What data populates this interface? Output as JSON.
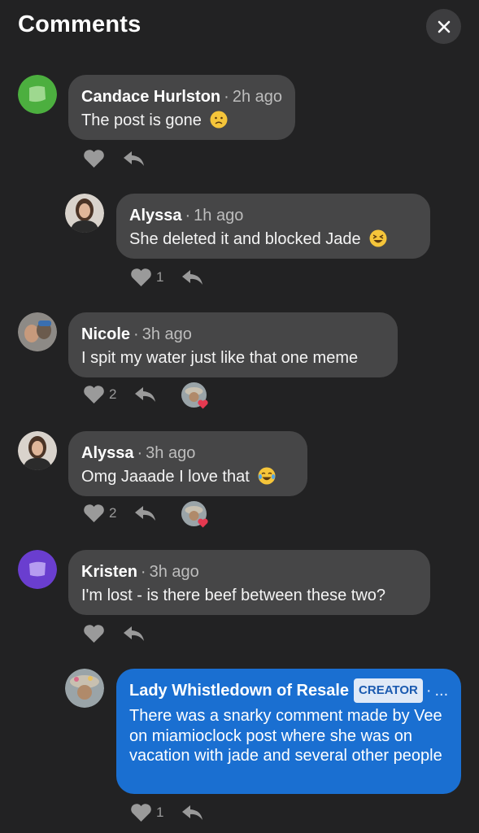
{
  "header": {
    "title": "Comments",
    "close_icon": "close-icon"
  },
  "colors": {
    "background": "#222223",
    "bubble": "#464647",
    "creator_bubble": "#1a6fd1",
    "icon": "#9a9a9a",
    "react_heart": "#e53950"
  },
  "comments": [
    {
      "name": "Candace Hurlston",
      "time": "2h ago",
      "text": "The post is gone",
      "emoji": "sad-face-emoji",
      "likes": ""
    },
    {
      "name": "Alyssa",
      "time": "1h ago",
      "text": "She deleted it and blocked Jade",
      "emoji": "laughing-squint-emoji",
      "likes": "1"
    },
    {
      "name": "Nicole",
      "time": "3h ago",
      "text": "I spit my water just like that one meme",
      "likes": "2"
    },
    {
      "name": "Alyssa",
      "time": "3h ago",
      "text": "Omg Jaaade I love that",
      "emoji": "tears-of-joy-emoji",
      "likes": "2"
    },
    {
      "name": "Kristen",
      "time": "3h ago",
      "text": "I'm lost - is there beef between these two?",
      "likes": ""
    },
    {
      "name": "Lady Whistledown of Resale",
      "badge": "CREATOR",
      "time": "...",
      "text": "There was a snarky comment made by Vee on miamioclock post where she was on vacation with jade and several other people",
      "likes": "1"
    }
  ]
}
